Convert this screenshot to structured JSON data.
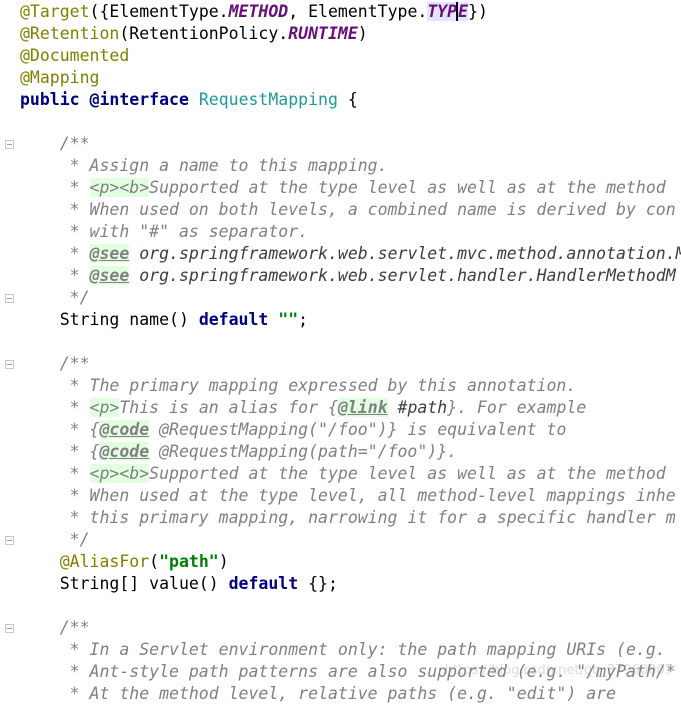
{
  "editor": {
    "lines": [
      [
        {
          "t": "@Target",
          "c": "ann"
        },
        {
          "t": "({ElementType.",
          "c": ""
        },
        {
          "t": "METHOD",
          "c": "it"
        },
        {
          "t": ", ElementType.",
          "c": ""
        },
        {
          "t": "TYP",
          "c": "it hl"
        },
        {
          "t": "E",
          "c": "it hl caret"
        },
        {
          "t": "})",
          "c": ""
        }
      ],
      [
        {
          "t": "@Retention",
          "c": "ann"
        },
        {
          "t": "(RetentionPolicy.",
          "c": ""
        },
        {
          "t": "RUNTIME",
          "c": "it"
        },
        {
          "t": ")",
          "c": ""
        }
      ],
      [
        {
          "t": "@Documented",
          "c": "ann"
        }
      ],
      [
        {
          "t": "@Mapping",
          "c": "ann"
        }
      ],
      [
        {
          "t": "public ",
          "c": "kw"
        },
        {
          "t": "@interface ",
          "c": "kw"
        },
        {
          "t": "RequestMapping",
          "c": "cls"
        },
        {
          "t": " {",
          "c": ""
        }
      ],
      [],
      [
        {
          "t": "    /**",
          "c": "cmt"
        }
      ],
      [
        {
          "t": "     * Assign a name to this mapping.",
          "c": "cmt"
        }
      ],
      [
        {
          "t": "     * ",
          "c": "cmt"
        },
        {
          "t": "<p><b>",
          "c": "tag"
        },
        {
          "t": "Supported at the type level as well as at the method",
          "c": "cmt"
        }
      ],
      [
        {
          "t": "     * When used on both levels, a combined name is derived by con",
          "c": "cmt"
        }
      ],
      [
        {
          "t": "     * with \"#\" as separator.",
          "c": "cmt"
        }
      ],
      [
        {
          "t": "     * ",
          "c": "cmt"
        },
        {
          "t": "@see",
          "c": "doctag"
        },
        {
          "t": " org.springframework.web.servlet.mvc.method.annotation.M",
          "c": "ref"
        }
      ],
      [
        {
          "t": "     * ",
          "c": "cmt"
        },
        {
          "t": "@see",
          "c": "doctag"
        },
        {
          "t": " org.springframework.web.servlet.handler.HandlerMethodM",
          "c": "ref"
        }
      ],
      [
        {
          "t": "     */",
          "c": "cmt"
        }
      ],
      [
        {
          "t": "    String name() ",
          "c": ""
        },
        {
          "t": "default ",
          "c": "kw"
        },
        {
          "t": "\"\"",
          "c": "str"
        },
        {
          "t": ";",
          "c": ""
        }
      ],
      [],
      [
        {
          "t": "    /**",
          "c": "cmt"
        }
      ],
      [
        {
          "t": "     * The primary mapping expressed by this annotation.",
          "c": "cmt"
        }
      ],
      [
        {
          "t": "     * ",
          "c": "cmt"
        },
        {
          "t": "<p>",
          "c": "tag"
        },
        {
          "t": "This is an alias for {",
          "c": "cmt"
        },
        {
          "t": "@link",
          "c": "doctag"
        },
        {
          "t": " #path",
          "c": "ref"
        },
        {
          "t": "}. For example",
          "c": "cmt"
        }
      ],
      [
        {
          "t": "     * {",
          "c": "cmt"
        },
        {
          "t": "@code",
          "c": "doctag"
        },
        {
          "t": " @RequestMapping(\"/foo\")} is equivalent to",
          "c": "cmt"
        }
      ],
      [
        {
          "t": "     * {",
          "c": "cmt"
        },
        {
          "t": "@code",
          "c": "doctag"
        },
        {
          "t": " @RequestMapping(path=\"/foo\")}.",
          "c": "cmt"
        }
      ],
      [
        {
          "t": "     * ",
          "c": "cmt"
        },
        {
          "t": "<p><b>",
          "c": "tag"
        },
        {
          "t": "Supported at the type level as well as at the method",
          "c": "cmt"
        }
      ],
      [
        {
          "t": "     * When used at the type level, all method-level mappings inhe",
          "c": "cmt"
        }
      ],
      [
        {
          "t": "     * this primary mapping, narrowing it for a specific handler m",
          "c": "cmt"
        }
      ],
      [
        {
          "t": "     */",
          "c": "cmt"
        }
      ],
      [
        {
          "t": "    ",
          "c": ""
        },
        {
          "t": "@AliasFor",
          "c": "ann"
        },
        {
          "t": "(",
          "c": ""
        },
        {
          "t": "\"path\"",
          "c": "str"
        },
        {
          "t": ")",
          "c": ""
        }
      ],
      [
        {
          "t": "    String[] value() ",
          "c": ""
        },
        {
          "t": "default ",
          "c": "kw"
        },
        {
          "t": "{};",
          "c": ""
        }
      ],
      [],
      [
        {
          "t": "    /**",
          "c": "cmt"
        }
      ],
      [
        {
          "t": "     * In a Servlet environment only: the path mapping URIs (e.g. ",
          "c": "cmt"
        }
      ],
      [
        {
          "t": "     * Ant-style path patterns are also supported (e.g. \"/myPath/*",
          "c": "cmt"
        }
      ],
      [
        {
          "t": "     * At the method level, relative paths (e.g. \"edit\") are",
          "c": "cmt"
        }
      ]
    ],
    "watermark": "https://blog.csdn.net/qq_37960007"
  }
}
